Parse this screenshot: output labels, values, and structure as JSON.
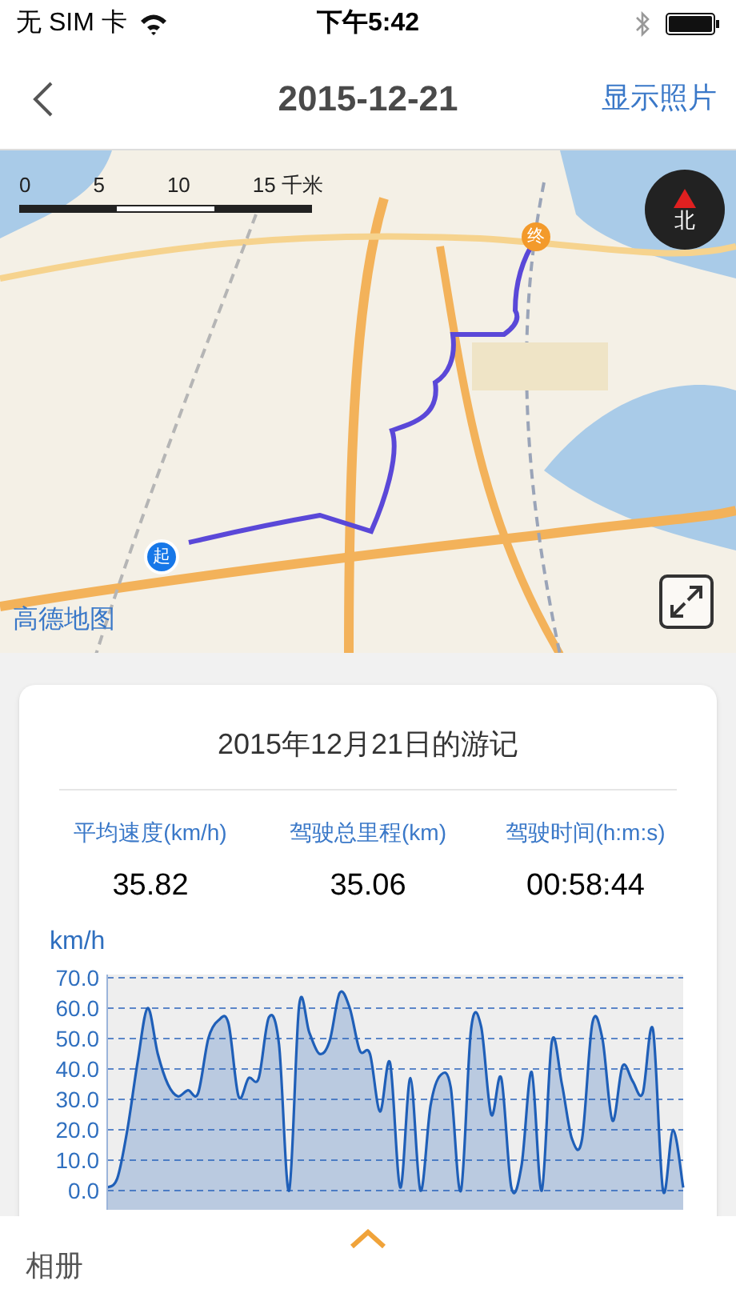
{
  "status_bar": {
    "carrier": "无 SIM 卡",
    "time": "下午5:42"
  },
  "nav": {
    "title": "2015-12-21",
    "action": "显示照片"
  },
  "map": {
    "scale_labels": [
      "0",
      "5",
      "10",
      "15 千米"
    ],
    "compass": "北",
    "start_marker": "起",
    "end_marker": "终",
    "logo": "高德地图"
  },
  "summary": {
    "title": "2015年12月21日的游记",
    "stats": [
      {
        "label": "平均速度(km/h)",
        "value": "35.82"
      },
      {
        "label": "驾驶总里程(km)",
        "value": "35.06"
      },
      {
        "label": "驾驶时间(h:m:s)",
        "value": "00:58:44"
      }
    ],
    "chart_data": {
      "type": "area",
      "grid": true,
      "ylabel": "km/h",
      "ylim": [
        0,
        70
      ],
      "yticks": [
        {
          "value": 0,
          "label": "0.0"
        },
        {
          "value": 10,
          "label": "10.0"
        },
        {
          "value": 20,
          "label": "20.0"
        },
        {
          "value": 30,
          "label": "30.0"
        },
        {
          "value": 40,
          "label": "40.0"
        },
        {
          "value": 50,
          "label": "50.0"
        },
        {
          "value": 60,
          "label": "60.0"
        },
        {
          "value": 70,
          "label": "70.0"
        }
      ],
      "series": [
        {
          "color": "#1f5fb8",
          "values": [
            1,
            4,
            20,
            42,
            60,
            45,
            35,
            31,
            33,
            32,
            50,
            56,
            55,
            31,
            37,
            37,
            57,
            48,
            0,
            61,
            52,
            45,
            49,
            65,
            60,
            46,
            45,
            26,
            42,
            1,
            37,
            0,
            28,
            38,
            34,
            0,
            53,
            54,
            25,
            37,
            1,
            8,
            39,
            0,
            49,
            35,
            17,
            17,
            55,
            50,
            23,
            41,
            36,
            32,
            53,
            0,
            20,
            1
          ]
        }
      ]
    }
  },
  "bottom_bar": {
    "label": "相册"
  }
}
